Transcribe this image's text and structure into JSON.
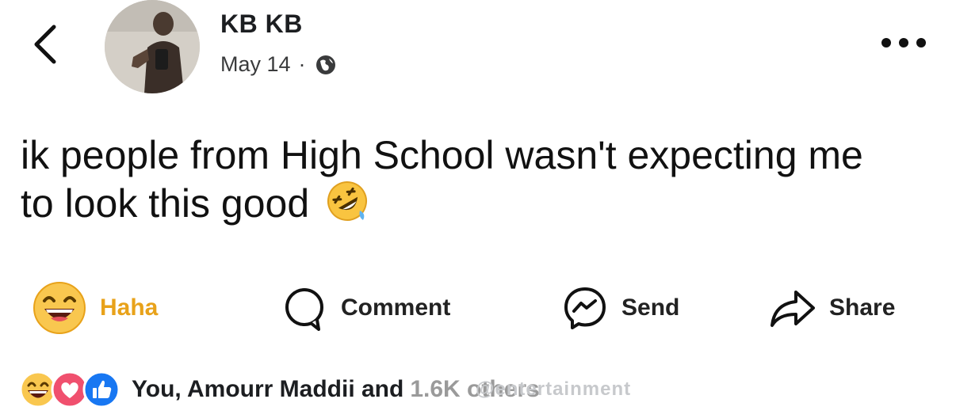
{
  "header": {
    "author_name": "KB KB",
    "date": "May 14",
    "separator": "·",
    "audience_icon": "globe-icon"
  },
  "post": {
    "text": "ik people from High School wasn't expecting me to look this good",
    "emoji": "rolling-on-floor-laughing-emoji"
  },
  "actions": {
    "haha_label": "Haha",
    "comment_label": "Comment",
    "send_label": "Send",
    "share_label": "Share"
  },
  "reactions": {
    "summary_prefix": "You, Amourr Maddii and",
    "summary_rest": "1.6K others",
    "icons": [
      "haha-reaction-icon",
      "love-reaction-icon",
      "like-reaction-icon"
    ]
  },
  "watermark": "@entertainment",
  "colors": {
    "haha_accent": "#e8a21a",
    "like_blue": "#1877f2",
    "love_red": "#f0506e"
  }
}
